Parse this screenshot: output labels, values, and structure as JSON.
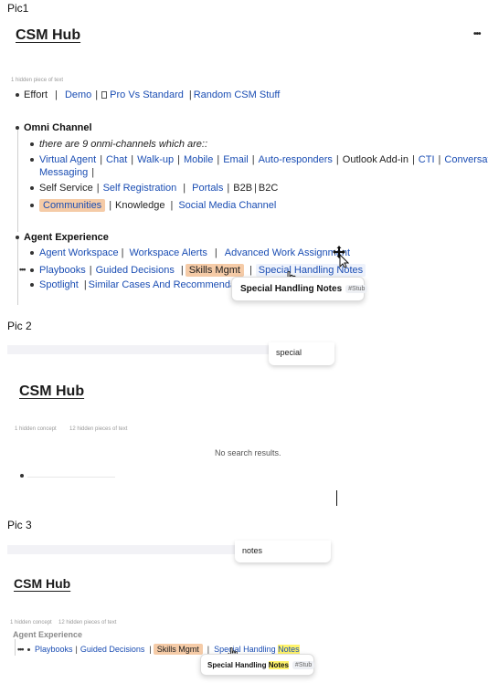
{
  "pic1": {
    "label": "Pic1",
    "title": "CSM Hub",
    "more_menu": "•••",
    "hidden_text": "1 hidden piece of text",
    "top_row": {
      "effort": "Effort",
      "demo": "Demo",
      "pro_vs_standard": "Pro Vs Standard",
      "random": "Random CSM Stuff"
    },
    "omni": {
      "heading": "Omni Channel",
      "note": "there are 9 onmi-channels which are::",
      "row1": [
        "Virtual Agent",
        "Chat",
        "Walk-up",
        "Mobile",
        "Email",
        "Auto-responders"
      ],
      "outlook": "Outlook Add-in",
      "cti": "CTI",
      "conv_1": "Conversational",
      "conv_2": "Messaging",
      "self_service": "Self Service",
      "self_registration": "Self Registration",
      "portals": "Portals",
      "b2b": "B2B",
      "b2c": "B2C",
      "communities": "Communities",
      "knowledge": "Knowledge",
      "social": "Social Media Channel"
    },
    "agent": {
      "heading": "Agent Experience",
      "workspace": "Agent Workspace",
      "alerts": "Workspace Alerts",
      "advanced": "Advanced Work Assignment",
      "playbooks": "Playbooks",
      "guided": "Guided Decisions",
      "skills": "Skills Mgmt",
      "special": "Special Handling Notes",
      "spotlight": "Spotlight",
      "similar": "Similar Cases And Recommendations"
    },
    "tooltip": {
      "title": "Special Handling Notes",
      "tag": "#Stub"
    }
  },
  "pic2": {
    "label": "Pic 2",
    "search_value": "special",
    "title": "CSM Hub",
    "hidden_concepts": "1 hidden concept",
    "hidden_text": "12 hidden pieces of text",
    "no_results": "No search results."
  },
  "pic3": {
    "label": "Pic 3",
    "search_value": "notes",
    "title": "CSM Hub",
    "hidden_concepts": "1 hidden concept",
    "hidden_text": "12 hidden pieces of text",
    "heading": "Agent Experience",
    "playbooks": "Playbooks",
    "guided": "Guided Decisions",
    "skills": "Skills Mgmt",
    "special_prefix": "Special Handling ",
    "special_match": "Notes",
    "tooltip": {
      "title_prefix": "Special Handling ",
      "title_match": "Notes",
      "tag": "#Stub"
    }
  }
}
